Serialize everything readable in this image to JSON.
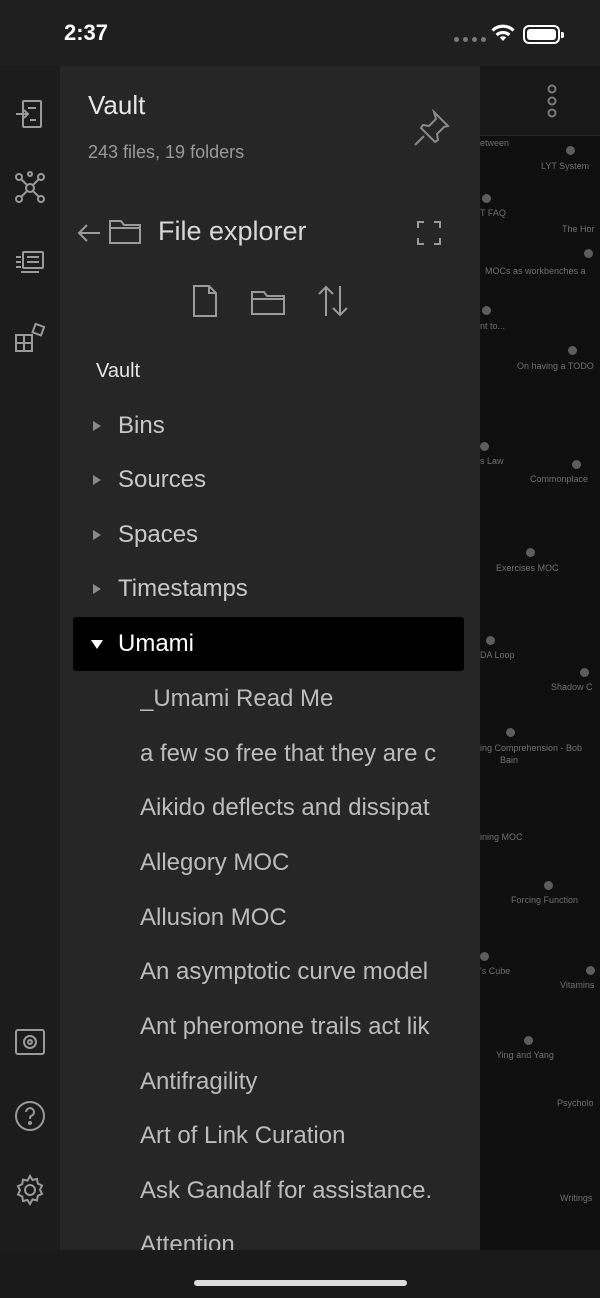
{
  "status": {
    "time": "2:37"
  },
  "vault": {
    "name": "Vault",
    "stats": "243 files, 19 folders"
  },
  "explorer": {
    "title": "File explorer",
    "root": "Vault"
  },
  "folders": [
    {
      "label": "Bins",
      "expanded": false
    },
    {
      "label": "Sources",
      "expanded": false
    },
    {
      "label": "Spaces",
      "expanded": false
    },
    {
      "label": "Timestamps",
      "expanded": false
    },
    {
      "label": "Umami",
      "expanded": true
    }
  ],
  "files": [
    "_Umami Read Me",
    "a few so free that they are c",
    "Aikido deflects and dissipat",
    "Allegory MOC",
    "Allusion MOC",
    "An asymptotic curve model",
    "Ant pheromone trails act lik",
    "Antifragility",
    "Art of Link Curation",
    "Ask Gandalf for assistance.",
    "Attention"
  ],
  "graph_labels": [
    "etween",
    "LYT System",
    "T FAQ",
    "The Hor",
    "MOCs as workbenches a",
    "nt to...",
    "On having a TODO",
    "s Law",
    "Commonplace",
    "Exercises MOC",
    "DA Loop",
    "Shadow C",
    "ing Comprehension - Bob",
    "Bain",
    "ining MOC",
    "Forcing Function",
    "'s Cube",
    "Vitamins",
    "Ying and Yang",
    "Psycholo",
    "Writings"
  ]
}
